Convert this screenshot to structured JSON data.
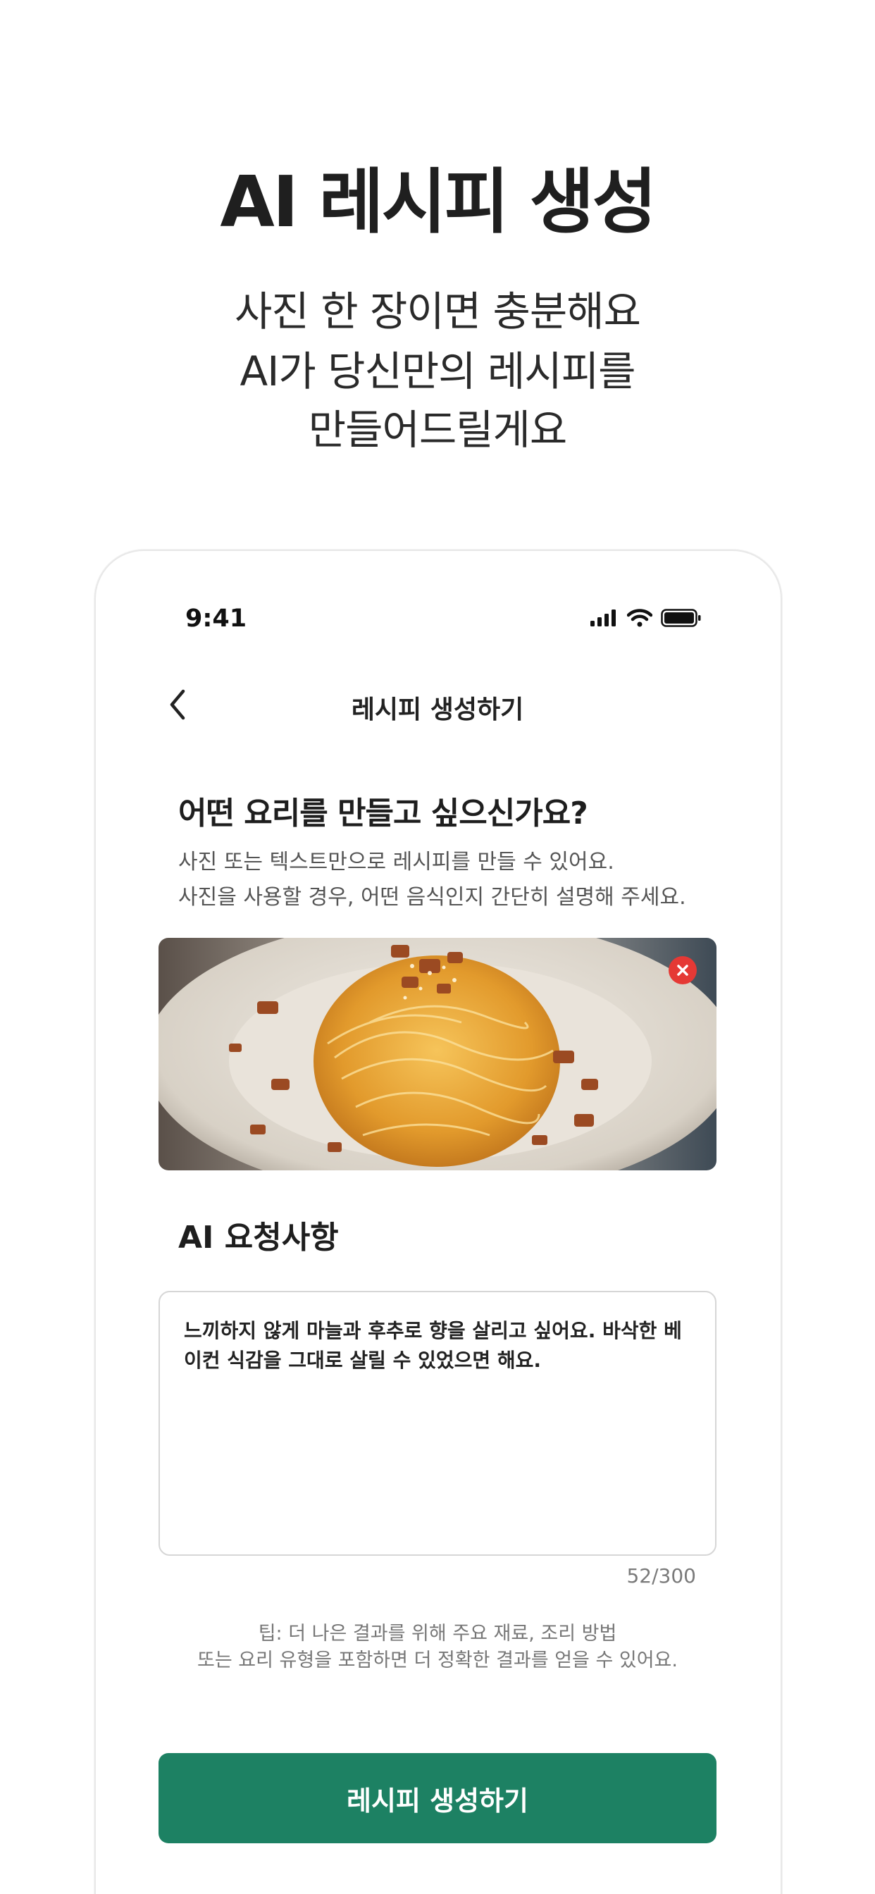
{
  "hero": {
    "title": "AI 레시피 생성",
    "subtitle_lines": [
      "사진 한 장이면 충분해요",
      "AI가 당신만의 레시피를",
      "만들어드릴게요"
    ]
  },
  "status_bar": {
    "time": "9:41",
    "icons": [
      "signal-icon",
      "wifi-icon",
      "battery-icon"
    ]
  },
  "nav": {
    "back_icon": "chevron-left-icon",
    "title": "레시피 생성하기"
  },
  "question": {
    "title": "어떤 요리를 만들고 싶으신가요?",
    "desc_lines": [
      "사진 또는 텍스트만으로 레시피를 만들 수 있어요.",
      "사진을 사용할 경우, 어떤 음식인지 간단히 설명해 주세요."
    ]
  },
  "photo": {
    "remove_icon": "close-icon"
  },
  "ai_request": {
    "title": "AI 요청사항",
    "value": "느끼하지 않게 마늘과 후추로 향을 살리고 싶어요. 바삭한 베이컨 식감을 그대로 살릴 수 있었으면 해요.",
    "counter": "52/300"
  },
  "tip": {
    "lines": [
      "팁: 더 나은 결과를 위해 주요 재료, 조리 방법",
      "또는 요리 유형을 포함하면 더 정확한 결과를 얻을 수 있어요."
    ]
  },
  "cta": {
    "label": "레시피 생성하기"
  },
  "colors": {
    "accent": "#1d8163",
    "remove": "#e53935"
  }
}
